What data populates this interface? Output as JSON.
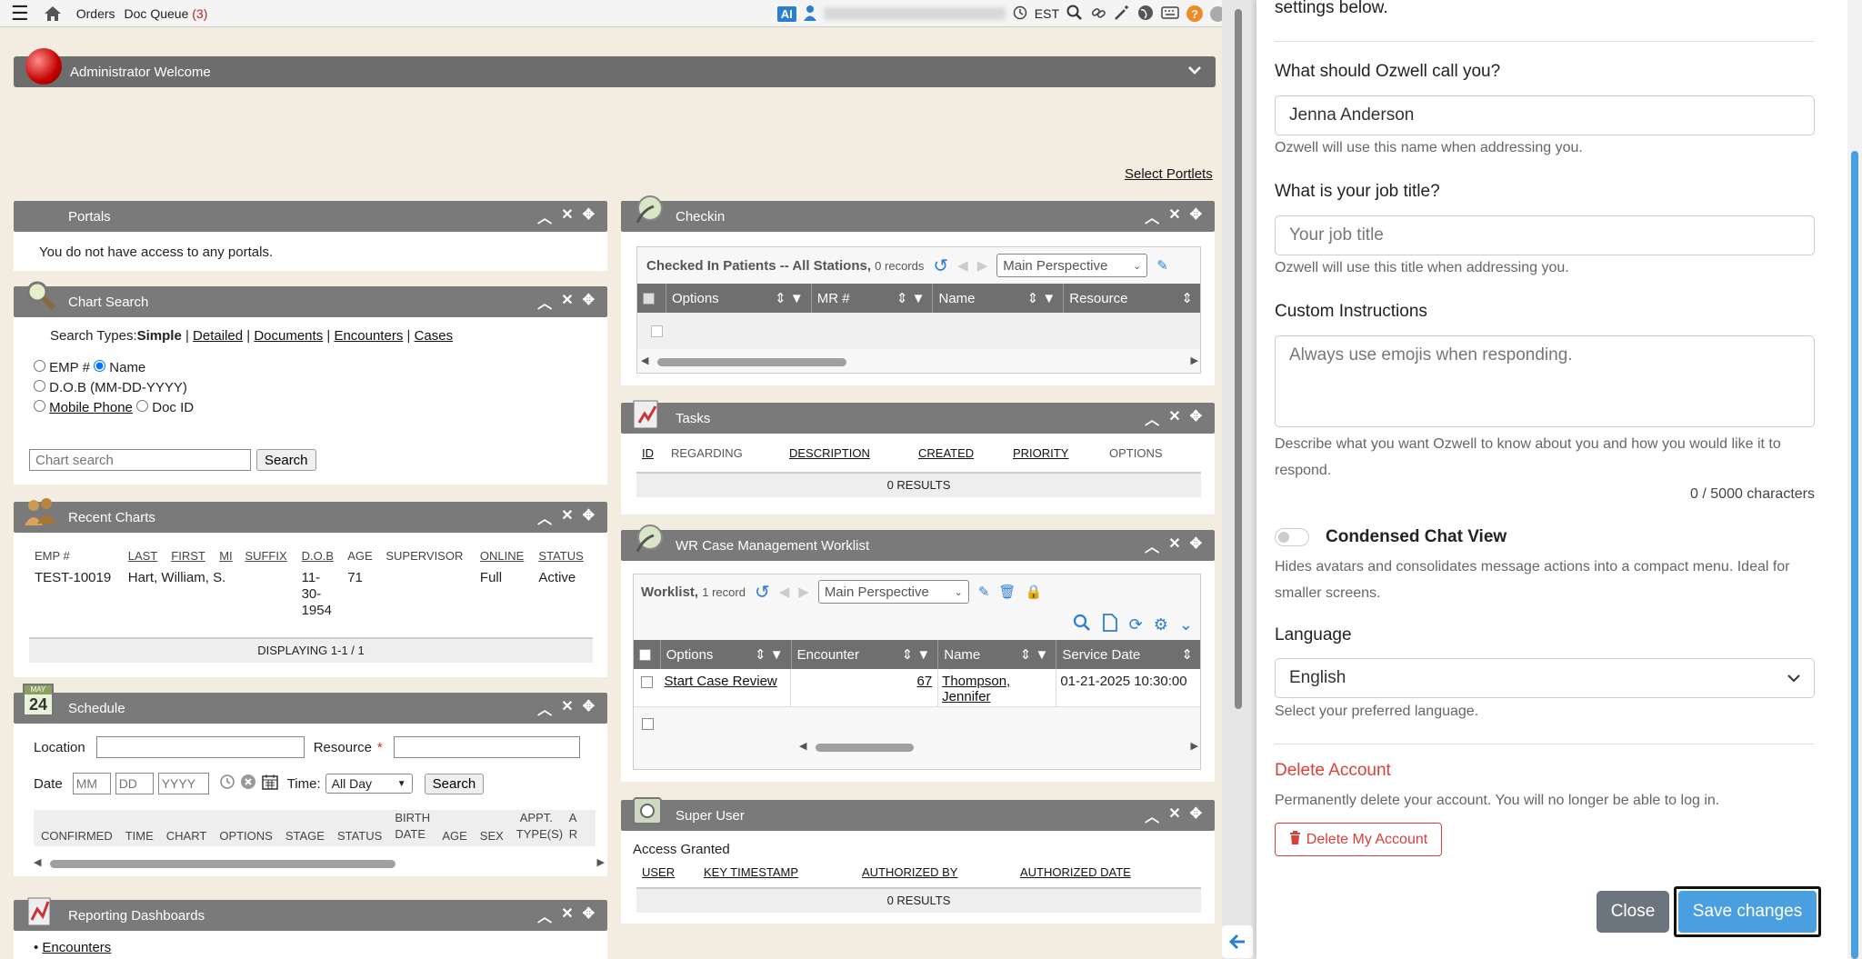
{
  "topbar": {
    "orders": "Orders",
    "doc_queue": "Doc Queue",
    "doc_queue_count": "(3)",
    "ai": "AI",
    "tz": "EST"
  },
  "welcome": {
    "title": "Administrator Welcome"
  },
  "select_portlets": "Select Portlets",
  "portals": {
    "title": "Portals",
    "message": "You do not have access to any portals."
  },
  "chart_search": {
    "title": "Chart Search",
    "search_types_label": "Search Types:",
    "types": [
      "Simple",
      "Detailed",
      "Documents",
      "Encounters",
      "Cases"
    ],
    "radio_emp": "EMP #",
    "radio_name": "Name",
    "radio_dob": "D.O.B (MM-DD-YYYY)",
    "radio_mobile": "Mobile Phone",
    "radio_docid": "Doc ID",
    "placeholder": "Chart search",
    "search_btn": "Search"
  },
  "recent_charts": {
    "title": "Recent Charts",
    "columns": [
      "EMP #",
      "LAST",
      "FIRST",
      "MI",
      "SUFFIX",
      "D.O.B",
      "AGE",
      "SUPERVISOR",
      "ONLINE",
      "STATUS"
    ],
    "row": {
      "emp": "TEST-10019",
      "name": "Hart, William, S.",
      "dob": "11-\n30-\n1954",
      "age": "71",
      "online": "Full",
      "status": "Active"
    },
    "footer": "DISPLAYING 1-1 / 1"
  },
  "schedule": {
    "title": "Schedule",
    "cal_month": "MAY",
    "cal_day": "24",
    "location": "Location",
    "resource": "Resource",
    "required": "*",
    "date": "Date",
    "mm": "MM",
    "dd": "DD",
    "yyyy": "YYYY",
    "time": "Time:",
    "time_value": "All Day",
    "search_btn": "Search",
    "columns": [
      "CONFIRMED",
      "TIME",
      "CHART",
      "OPTIONS",
      "STAGE",
      "STATUS",
      "BIRTH DATE",
      "AGE",
      "SEX",
      "APPT. TYPE(S)",
      "A R"
    ]
  },
  "reporting": {
    "title": "Reporting Dashboards",
    "item": "Encounters"
  },
  "checkin": {
    "title": "Checkin",
    "subtitle": "Checked In Patients -- All Stations,",
    "records": "0 records",
    "perspective": "Main Perspective",
    "columns": [
      "Options",
      "MR #",
      "Name",
      "Resource"
    ]
  },
  "tasks": {
    "title": "Tasks",
    "columns": [
      "ID",
      "REGARDING",
      "DESCRIPTION",
      "CREATED",
      "PRIORITY",
      "OPTIONS"
    ],
    "footer": "0 RESULTS"
  },
  "worklist": {
    "title": "WR Case Management Worklist",
    "subtitle": "Worklist,",
    "records": "1 record",
    "perspective": "Main Perspective",
    "columns": [
      "Options",
      "Encounter",
      "Name",
      "Service Date"
    ],
    "row": {
      "option": "Start Case Review",
      "encounter": "67",
      "name1": "Thompson,",
      "name2": "Jennifer",
      "date": "01-21-2025 10:30:00"
    }
  },
  "super_user": {
    "title": "Super User",
    "access": "Access Granted",
    "columns": [
      "USER",
      "KEY TIMESTAMP",
      "AUTHORIZED BY",
      "AUTHORIZED DATE"
    ],
    "footer": "0 RESULTS"
  },
  "settings": {
    "intro": "settings below.",
    "name_label": "What should Ozwell call you?",
    "name_value": "Jenna Anderson",
    "name_help": "Ozwell will use this name when addressing you.",
    "job_label": "What is your job title?",
    "job_placeholder": "Your job title",
    "job_help": "Ozwell will use this title when addressing you.",
    "custom_label": "Custom Instructions",
    "custom_placeholder": "Always use emojis when responding.",
    "custom_help": "Describe what you want Ozwell to know about you and how you would like it to respond.",
    "char_count": "0 / 5000 characters",
    "condensed_label": "Condensed Chat View",
    "condensed_help": "Hides avatars and consolidates message actions into a compact menu. Ideal for smaller screens.",
    "language_label": "Language",
    "language_value": "English",
    "language_help": "Select your preferred language.",
    "delete_title": "Delete Account",
    "delete_help": "Permanently delete your account. You will no longer be able to log in.",
    "delete_btn": "Delete My Account",
    "close_btn": "Close",
    "save_btn": "Save changes"
  },
  "colors": {
    "accent": "#4a9fe0",
    "danger": "#d9403a",
    "header_gray": "#7a7a7a",
    "bg": "#f2ede0"
  }
}
